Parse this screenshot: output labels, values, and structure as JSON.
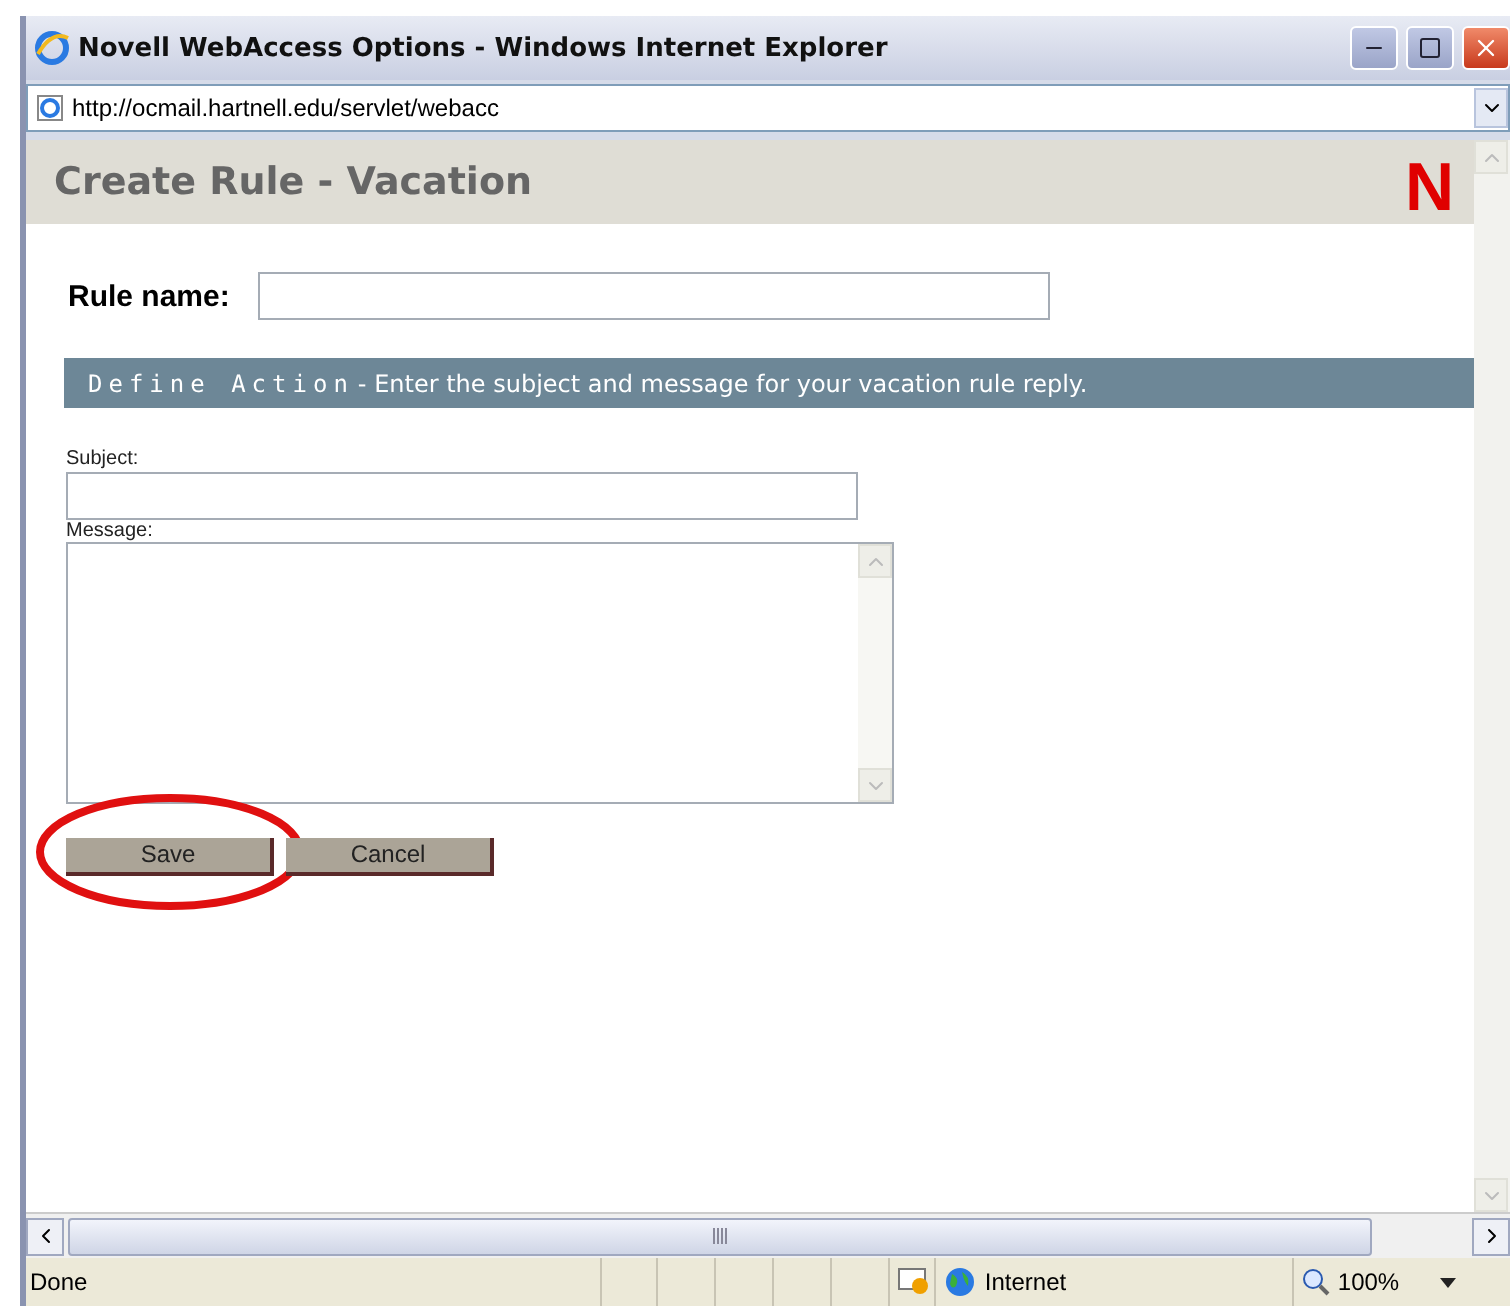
{
  "window": {
    "title": "Novell WebAccess Options - Windows Internet Explorer"
  },
  "address_bar": {
    "url": "http://ocmail.hartnell.edu/servlet/webacc"
  },
  "page": {
    "title": "Create Rule - Vacation",
    "logo": "N",
    "rule_name": {
      "label": "Rule name:"
    },
    "section": {
      "heading": "Define Action",
      "description": "- Enter the subject and message for your vacation rule reply."
    },
    "subject": {
      "label": "Subject:"
    },
    "message": {
      "label": "Message:"
    },
    "buttons": [
      {
        "label": "Save",
        "highlighted": true
      },
      {
        "label": "Cancel",
        "highlighted": false
      }
    ]
  },
  "status_bar": {
    "status": "Done",
    "zone": "Internet",
    "zoom": "100%"
  }
}
